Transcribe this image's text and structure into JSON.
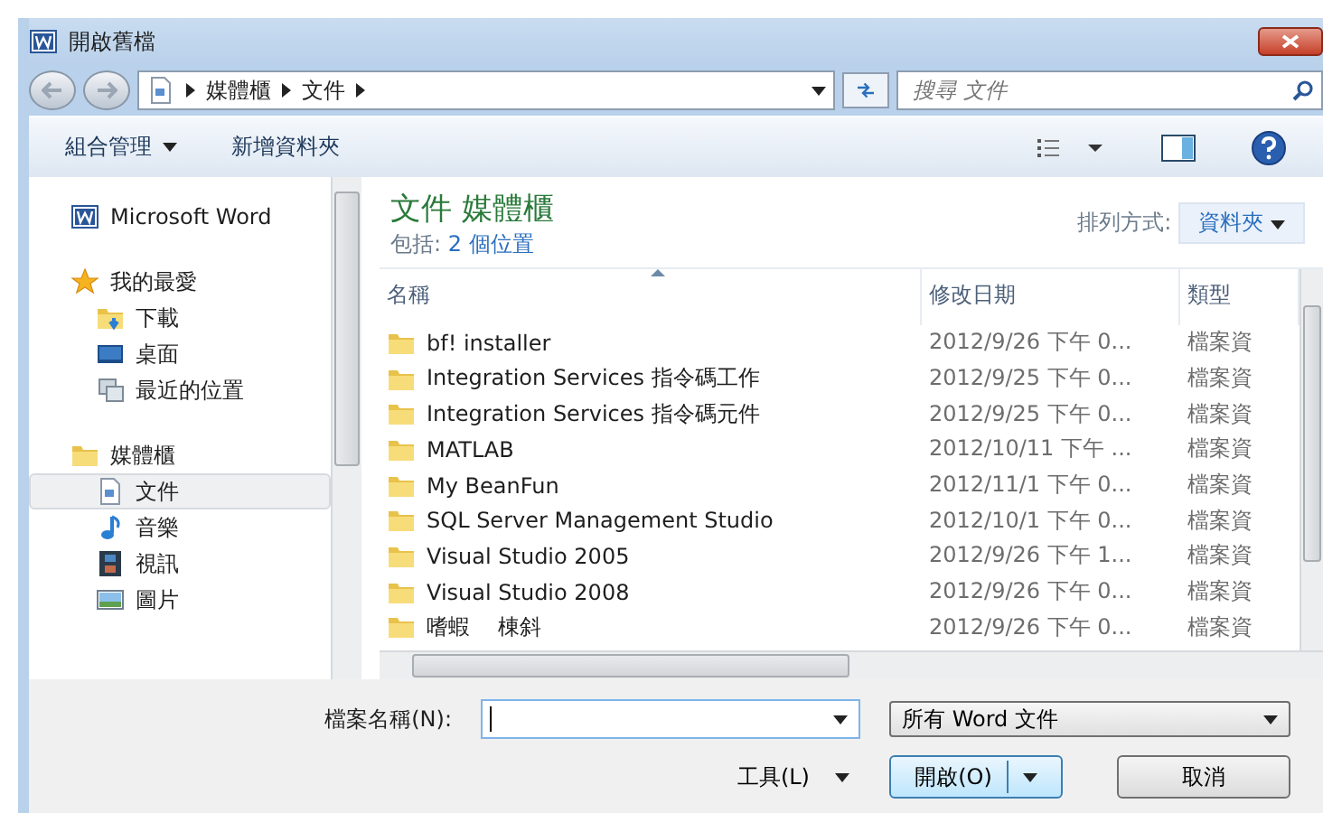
{
  "window": {
    "title": "開啟舊檔"
  },
  "address": {
    "crumbs": [
      "媒體櫃",
      "文件"
    ]
  },
  "search": {
    "placeholder": "搜尋 文件"
  },
  "toolbar": {
    "organize": "組合管理",
    "new_folder": "新增資料夾"
  },
  "sidebar": {
    "items": [
      {
        "label": "Microsoft Word",
        "kind": "word",
        "selected": false
      },
      {
        "label": "我的最愛",
        "kind": "favorites",
        "selected": false,
        "children": [
          {
            "label": "下載",
            "kind": "downloads",
            "selected": false
          },
          {
            "label": "桌面",
            "kind": "desktop",
            "selected": false
          },
          {
            "label": "最近的位置",
            "kind": "recent",
            "selected": false
          }
        ]
      },
      {
        "label": "媒體櫃",
        "kind": "libraries",
        "selected": false,
        "children": [
          {
            "label": "文件",
            "kind": "documents",
            "selected": true
          },
          {
            "label": "音樂",
            "kind": "music",
            "selected": false
          },
          {
            "label": "視訊",
            "kind": "videos",
            "selected": false
          },
          {
            "label": "圖片",
            "kind": "pictures",
            "selected": false
          }
        ]
      }
    ]
  },
  "library": {
    "title": "文件 媒體櫃",
    "includes_label": "包括:",
    "includes_link": "2 個位置",
    "arrange_label": "排列方式:",
    "arrange_value": "資料夾"
  },
  "table": {
    "columns": [
      {
        "label": "名稱",
        "sorted": true
      },
      {
        "label": "修改日期",
        "sorted": false
      },
      {
        "label": "類型",
        "sorted": false
      }
    ],
    "rows": [
      {
        "name": "bf! installer",
        "date": "2012/9/26 下午 0...",
        "type": "檔案資"
      },
      {
        "name": "Integration Services 指令碼工作",
        "date": "2012/9/25 下午 0...",
        "type": "檔案資"
      },
      {
        "name": "Integration Services 指令碼元件",
        "date": "2012/9/25 下午 0...",
        "type": "檔案資"
      },
      {
        "name": "MATLAB",
        "date": "2012/10/11 下午 ...",
        "type": "檔案資"
      },
      {
        "name": "My BeanFun",
        "date": "2012/11/1 下午 0...",
        "type": "檔案資"
      },
      {
        "name": "SQL Server Management Studio",
        "date": "2012/10/1 下午 0...",
        "type": "檔案資"
      },
      {
        "name": "Visual Studio 2005",
        "date": "2012/9/26 下午 1...",
        "type": "檔案資"
      },
      {
        "name": "Visual Studio 2008",
        "date": "2012/9/26 下午 0...",
        "type": "檔案資"
      },
      {
        "name": "嗜蝦    棟斜",
        "date": "2012/9/26 下午 0...",
        "type": "檔案資"
      }
    ]
  },
  "footer": {
    "filename_label": "檔案名稱(N):",
    "filter": "所有 Word 文件",
    "tools": "工具(L)",
    "open": "開啟(O)",
    "cancel": "取消"
  }
}
